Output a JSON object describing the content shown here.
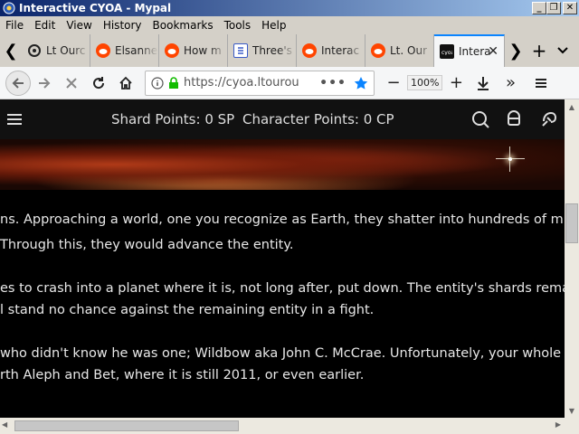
{
  "window": {
    "title": "Interactive CYOA - Mypal",
    "minimize": "_",
    "maximize": "❐",
    "close": "✕"
  },
  "menu": [
    "File",
    "Edit",
    "View",
    "History",
    "Bookmarks",
    "Tools",
    "Help"
  ],
  "tabs": [
    {
      "label": "Lt Ourc",
      "icon": "cyoa-icon"
    },
    {
      "label": "Elsanne",
      "icon": "reddit-icon"
    },
    {
      "label": "How m",
      "icon": "reddit-icon"
    },
    {
      "label": "Three's",
      "icon": "document-icon"
    },
    {
      "label": "Interac",
      "icon": "reddit-icon"
    },
    {
      "label": "Lt. Our",
      "icon": "reddit-icon"
    },
    {
      "label": "Intera",
      "icon": "cyoa-icon",
      "active": true
    }
  ],
  "tab_scroll_left": "❮",
  "tab_scroll_right": "❯",
  "new_tab": "+",
  "nav": {
    "url": "https://cyoa.ltourou",
    "url_menu": "•••",
    "zoom": "100%",
    "zoom_out": "−",
    "zoom_in": "+",
    "overflow": "»"
  },
  "site": {
    "shard_label": "Shard Points:",
    "shard_value": "0",
    "shard_unit": "SP",
    "char_label": "Character Points:",
    "char_value": "0",
    "char_unit": "CP"
  },
  "body_lines": [
    "ns. Approaching a world, one you recognize as Earth, they shatter into hundreds of millions",
    "Through this, they would advance the entity.",
    "es to crash into a planet where it is, not long after, put down. The entity's shards remain, in th",
    "l stand no chance against the remaining entity in a fight.",
    "who didn't know he was one; Wildbow aka John C. McCrae. Unfortunately, your whole unive",
    "rth Aleph and Bet, where it is still 2011, or even earlier."
  ]
}
